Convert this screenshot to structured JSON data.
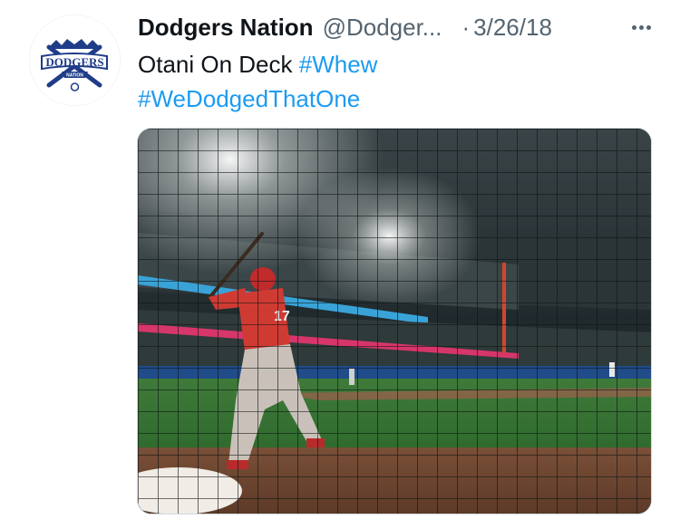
{
  "tweet": {
    "display_name": "Dodgers Nation",
    "handle": "@Dodger...",
    "separator": "·",
    "date": "3/26/18",
    "text_plain": "Otani On Deck",
    "hashtag_1": "#Whew",
    "hashtag_2": "#WeDodgedThatOne"
  },
  "avatar": {
    "logo_text_main": "DODGERS",
    "logo_text_sub": "NATION",
    "color": "#1f3c88"
  },
  "media": {
    "photo_subject": "baseball-batter-on-deck",
    "jersey_number": "17"
  },
  "icons": {
    "more": "more-dots-icon"
  },
  "colors": {
    "link": "#1d9bf0",
    "secondary_text": "#536471",
    "primary_text": "#0f1419"
  }
}
